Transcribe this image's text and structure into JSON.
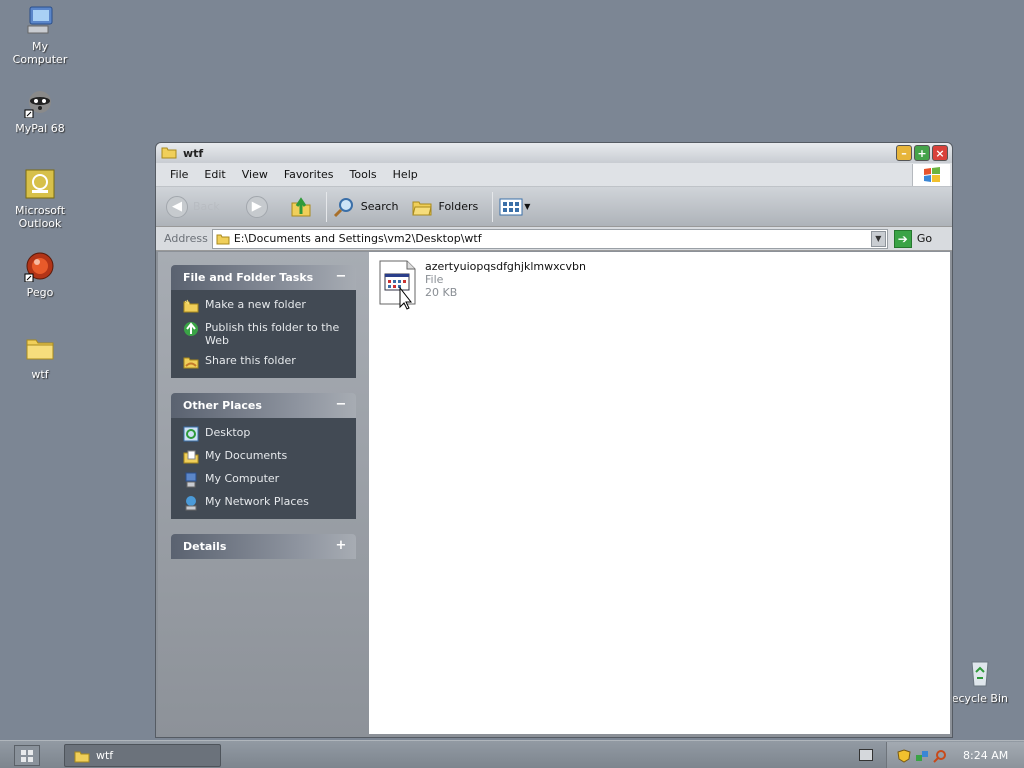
{
  "desktop": {
    "icons": [
      {
        "label": "My\nComputer"
      },
      {
        "label": "MyPal 68"
      },
      {
        "label": "Microsoft\nOutlook"
      },
      {
        "label": "Pego"
      },
      {
        "label": "wtf"
      },
      {
        "label": "ecycle Bin"
      }
    ]
  },
  "window": {
    "title": "wtf",
    "menu": [
      "File",
      "Edit",
      "View",
      "Favorites",
      "Tools",
      "Help"
    ],
    "toolbar": {
      "back_label": "Back",
      "search_label": "Search",
      "folders_label": "Folders"
    },
    "address": {
      "label": "Address",
      "value": "E:\\Documents and Settings\\vm2\\Desktop\\wtf",
      "go_label": "Go"
    },
    "tasks": {
      "file_folder": {
        "title": "File and Folder Tasks",
        "toggle": "−",
        "items": [
          "Make a new folder",
          "Publish this folder to the Web",
          "Share this folder"
        ]
      },
      "other_places": {
        "title": "Other Places",
        "toggle": "−",
        "items": [
          "Desktop",
          "My Documents",
          "My Computer",
          "My Network Places"
        ]
      },
      "details": {
        "title": "Details",
        "toggle": "+"
      }
    },
    "files": [
      {
        "name": "azertyuiopqsdfghjklmwxcvbn",
        "type": "File",
        "size": "20 KB"
      }
    ]
  },
  "taskbar": {
    "items": [
      {
        "label": "wtf"
      }
    ],
    "clock": "8:24 AM"
  }
}
